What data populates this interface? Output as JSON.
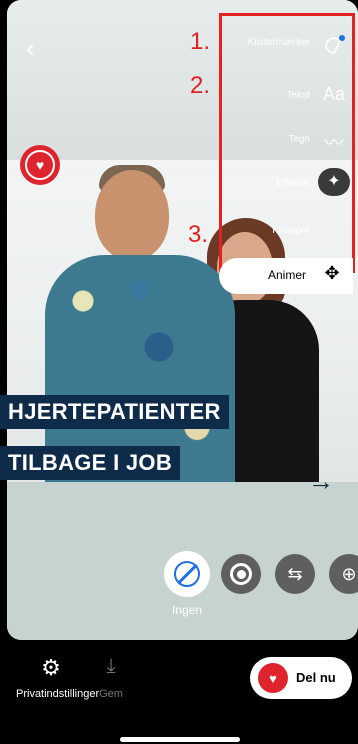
{
  "header": {
    "back_icon": "chevron-left-icon"
  },
  "toolbar": {
    "items": [
      {
        "label": "Klistermærker",
        "icon": "sticker-icon",
        "number": "1."
      },
      {
        "label": "Tekst",
        "icon": "text-aa-icon",
        "number": "2."
      },
      {
        "label": "Tegn",
        "icon": "draw-icon",
        "number": ""
      },
      {
        "label": "Effekter",
        "icon": "effects-icon",
        "number": ""
      },
      {
        "label": "Knapper",
        "icon": "link-icon",
        "number": "3."
      }
    ],
    "animate_label": "Animer",
    "animate_icon": "move-arrows-icon",
    "highlight_color": "#e52222"
  },
  "content": {
    "title_line_1": "HJERTEPATIENTER",
    "title_line_2": "TILBAGE I JOB",
    "arrow": "→"
  },
  "filters": {
    "selected_label": "Ingen",
    "buttons": [
      "none-icon",
      "record-icon",
      "swap-icon",
      "zoom-icon"
    ]
  },
  "bottom_bar": {
    "privacy_label": "Privatindstillinger",
    "save_label": "Gem",
    "share_label": "Del nu"
  },
  "colors": {
    "brand_red": "#e0242e",
    "accent_blue": "#1e6fe8",
    "title_bg": "#0f2b4a"
  }
}
